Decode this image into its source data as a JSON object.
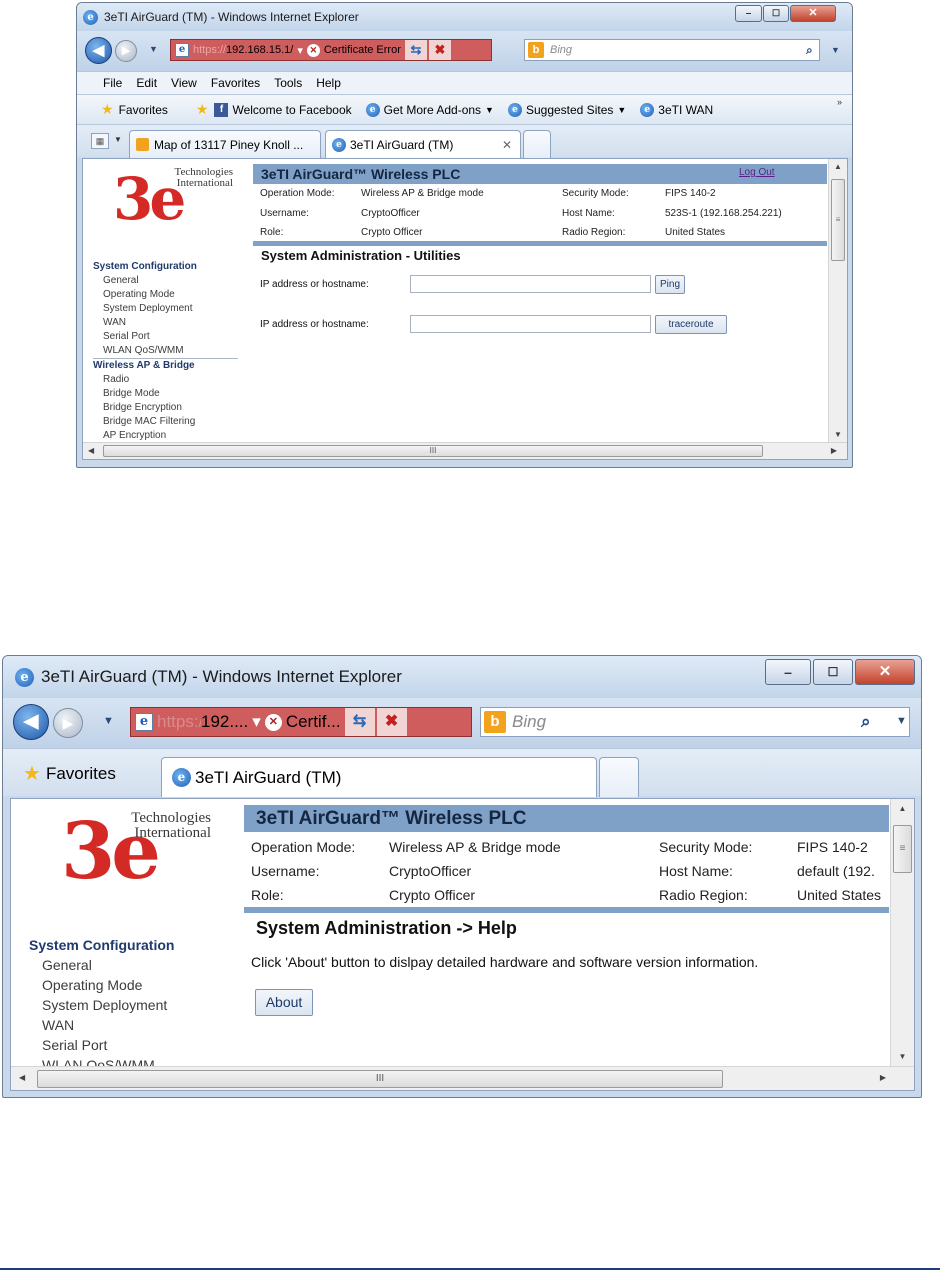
{
  "screenshot1": {
    "window_title": "3eTI AirGuard (TM) - Windows Internet Explorer",
    "address": {
      "protocol": "https://",
      "host": "192.168.15.1/",
      "cert_error": "Certificate Error"
    },
    "search_placeholder": "Bing",
    "menu": [
      "File",
      "Edit",
      "View",
      "Favorites",
      "Tools",
      "Help"
    ],
    "favorites_label": "Favorites",
    "favorites_items": [
      "Welcome to Facebook",
      "Get More Add-ons",
      "Suggested Sites",
      "3eTI WAN"
    ],
    "tabs": [
      "Map of 13117 Piney Knoll ...",
      "3eTI AirGuard (TM)"
    ],
    "logo_text": [
      "Technologies",
      "International"
    ],
    "logo_mark": "3e",
    "nav": {
      "section1": "System Configuration",
      "section1_items": [
        "General",
        "Operating Mode",
        "System Deployment",
        "WAN",
        "Serial Port",
        "WLAN QoS/WMM"
      ],
      "section2": "Wireless AP & Bridge",
      "section2_items": [
        "Radio",
        "Bridge Mode",
        "Bridge Encryption",
        "Bridge MAC Filtering",
        "AP Encryption"
      ]
    },
    "header_title": "3eTI AirGuard™ Wireless PLC",
    "logout": "Log Out",
    "info": {
      "op_mode_label": "Operation Mode:",
      "op_mode_value": "Wireless AP & Bridge mode",
      "sec_mode_label": "Security Mode:",
      "sec_mode_value": "FIPS 140-2",
      "user_label": "Username:",
      "user_value": "CryptoOfficer",
      "host_label": "Host Name:",
      "host_value": "523S-1 (192.168.254.221)",
      "role_label": "Role:",
      "role_value": "Crypto Officer",
      "region_label": "Radio Region:",
      "region_value": "United States"
    },
    "page_heading": "System Administration - Utilities",
    "ping_label": "IP address or hostname:",
    "ping_button": "Ping",
    "trace_label": "IP address or hostname:",
    "trace_button": "traceroute",
    "hscroll_grip": "III"
  },
  "screenshot2": {
    "window_title": "3eTI AirGuard (TM) - Windows Internet Explorer",
    "address": {
      "host": "192....",
      "cert_error": "Certif..."
    },
    "search_placeholder": "Bing",
    "favorites_label": "Favorites",
    "tab": "3eTI AirGuard (TM)",
    "logo_text": [
      "Technologies",
      "International"
    ],
    "logo_mark": "3e",
    "nav": {
      "section1": "System Configuration",
      "section1_items": [
        "General",
        "Operating Mode",
        "System Deployment",
        "WAN",
        "Serial Port",
        "WLAN QoS/WMM"
      ]
    },
    "header_title": "3eTI AirGuard™ Wireless PLC",
    "info": {
      "op_mode_label": "Operation Mode:",
      "op_mode_value": "Wireless AP & Bridge mode",
      "sec_mode_label": "Security Mode:",
      "sec_mode_value": "FIPS 140-2",
      "user_label": "Username:",
      "user_value": "CryptoOfficer",
      "host_label": "Host Name:",
      "host_value": "default (192.",
      "role_label": "Role:",
      "role_value": "Crypto Officer",
      "region_label": "Radio Region:",
      "region_value": "United States"
    },
    "page_heading": "System Administration -> Help",
    "help_text": "Click 'About' button to dislpay detailed hardware and software version information.",
    "about_button": "About",
    "hscroll_grip": "III"
  },
  "colors": {
    "header_band": "#7fa1c8",
    "logo_red": "#d42a25",
    "address_error": "#cf5d5d",
    "footer_rule": "#1f3d7a"
  }
}
